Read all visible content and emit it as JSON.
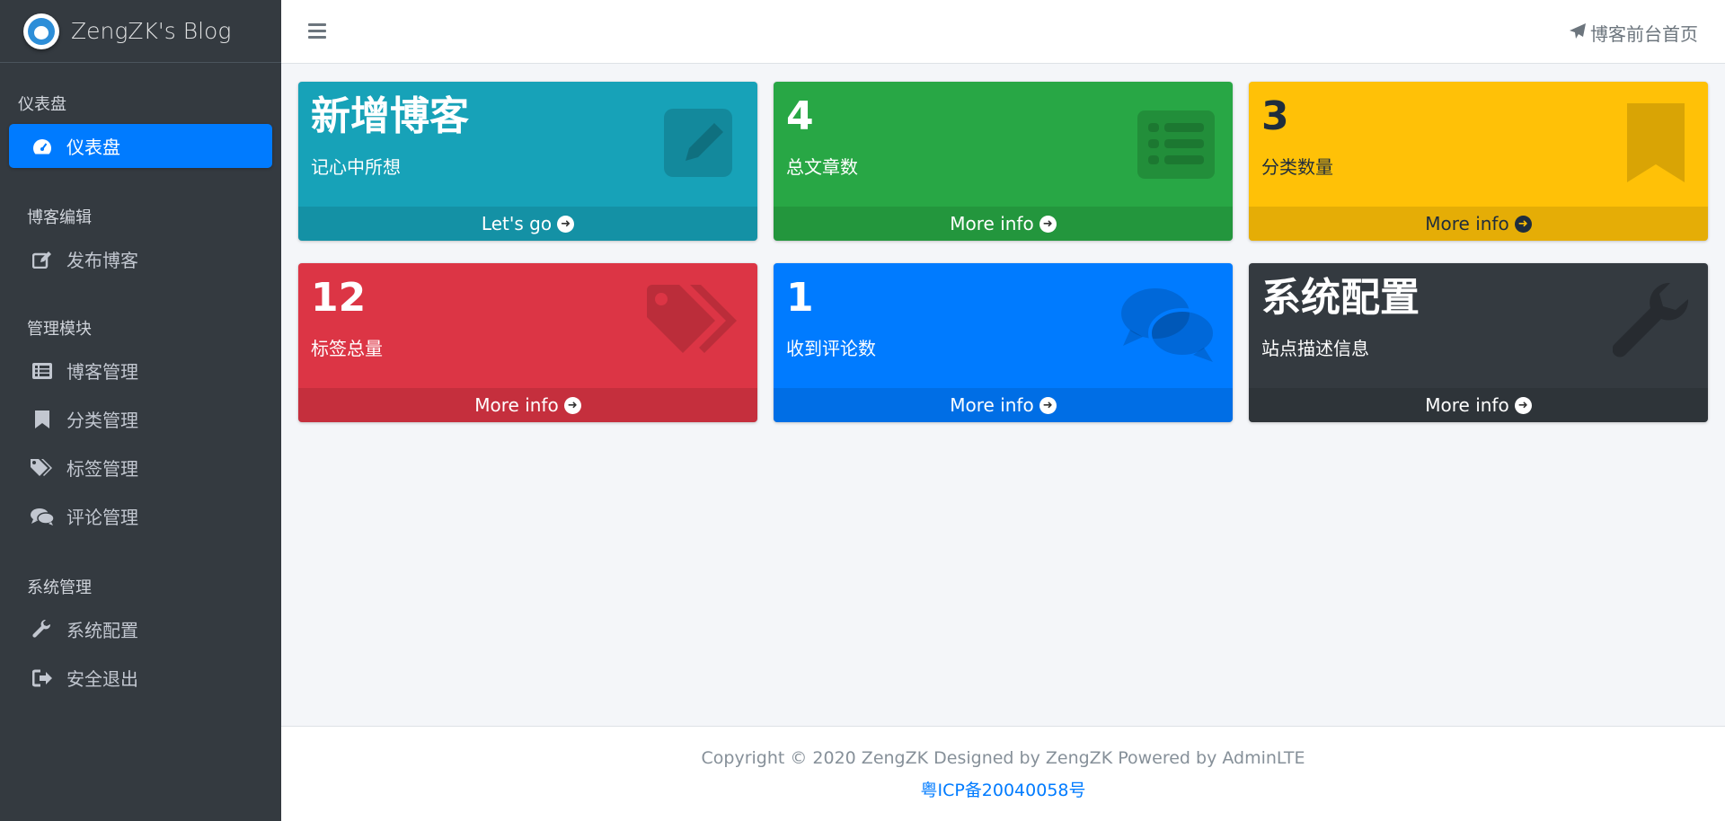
{
  "brand": {
    "title": "ZengZK's Blog"
  },
  "sidebar": {
    "dashboard_header": "仪表盘",
    "dashboard_item": "仪表盘",
    "sections": [
      {
        "header": "博客编辑",
        "items": [
          {
            "label": "发布博客",
            "icon": "edit-icon"
          }
        ]
      },
      {
        "header": "管理模块",
        "items": [
          {
            "label": "博客管理",
            "icon": "list-icon"
          },
          {
            "label": "分类管理",
            "icon": "bookmark-icon"
          },
          {
            "label": "标签管理",
            "icon": "tags-icon"
          },
          {
            "label": "评论管理",
            "icon": "comments-icon"
          }
        ]
      },
      {
        "header": "系统管理",
        "items": [
          {
            "label": "系统配置",
            "icon": "wrench-icon"
          },
          {
            "label": "安全退出",
            "icon": "sign-out-icon"
          }
        ]
      }
    ]
  },
  "topbar": {
    "front_link": "博客前台首页"
  },
  "cards": [
    {
      "big": "新增博客",
      "sub": "记心中所想",
      "footer": "Let's go",
      "color": "#17a2b8",
      "icon": "edit-icon"
    },
    {
      "big": "4",
      "sub": "总文章数",
      "footer": "More info",
      "color": "#28a745",
      "icon": "list-icon"
    },
    {
      "big": "3",
      "sub": "分类数量",
      "footer": "More info",
      "color": "#ffc107",
      "icon": "bookmark-icon"
    },
    {
      "big": "12",
      "sub": "标签总量",
      "footer": "More info",
      "color": "#dc3545",
      "icon": "tags-icon"
    },
    {
      "big": "1",
      "sub": "收到评论数",
      "footer": "More info",
      "color": "#007bff",
      "icon": "comments-icon"
    },
    {
      "big": "系统配置",
      "sub": "站点描述信息",
      "footer": "More info",
      "color": "#343a40",
      "icon": "wrench-icon"
    }
  ],
  "footer": {
    "copyright": "Copyright © 2020 ZengZK Designed by ZengZK Powered by AdminLTE",
    "icp": "粤ICP备20040058号"
  }
}
